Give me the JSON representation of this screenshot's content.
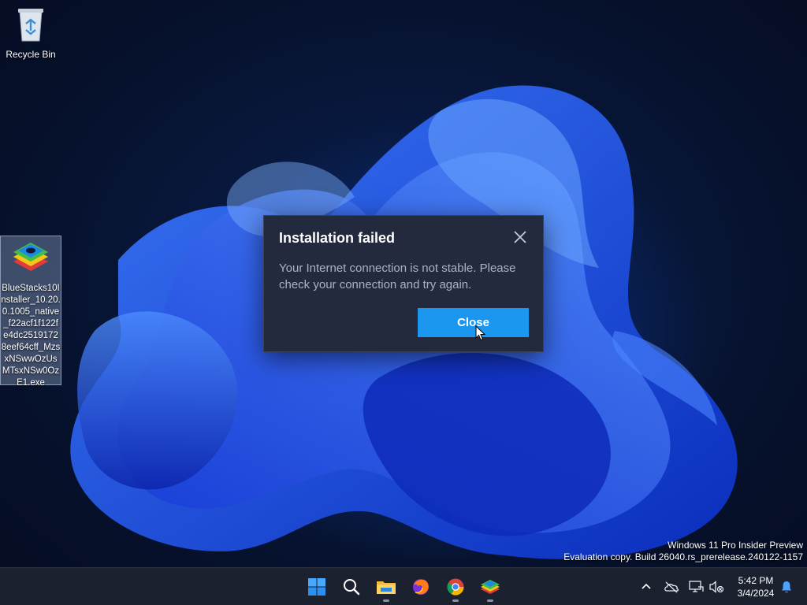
{
  "desktop": {
    "icons": [
      {
        "label": "Recycle Bin"
      },
      {
        "label": "BlueStacks10Installer_10.20.0.1005_native_f22acf1f122fe4dc25191728eef64cff_MzsxNSwwOzUsMTsxNSw0OzE1.exe"
      }
    ]
  },
  "dialog": {
    "title": "Installation failed",
    "message": "Your Internet connection is not stable. Please check your connection and try again.",
    "close_button_label": "Close",
    "accent_color": "#1c97ef"
  },
  "watermark": {
    "line1": "Windows 11 Pro Insider Preview",
    "line2": "Evaluation copy. Build 26040.rs_prerelease.240122-1157"
  },
  "taskbar": {
    "apps": [
      {
        "icon": "windows-start-icon"
      },
      {
        "icon": "search-icon"
      },
      {
        "icon": "file-explorer-icon"
      },
      {
        "icon": "firefox-icon"
      },
      {
        "icon": "chrome-icon"
      },
      {
        "icon": "bluestacks-icon"
      }
    ],
    "tray": {
      "icons": [
        "chevron-up-icon",
        "onedrive-offline-icon",
        "network-icon",
        "volume-muted-icon",
        "notification-bell-icon"
      ],
      "time": "5:42 PM",
      "date": "3/4/2024"
    }
  }
}
